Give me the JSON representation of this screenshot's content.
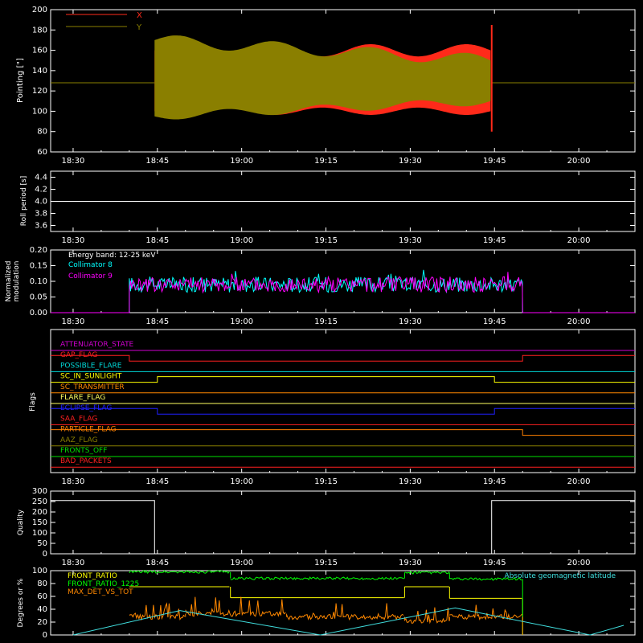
{
  "x_ticks": [
    "18:30",
    "18:45",
    "19:00",
    "19:15",
    "19:30",
    "19:45",
    "20:00"
  ],
  "chart_data": [
    {
      "type": "line",
      "ylabel": "Pointing [\"]",
      "ylim": [
        60,
        200
      ],
      "yticks": [
        60,
        80,
        100,
        120,
        140,
        160,
        180,
        200
      ],
      "series": [
        {
          "name": "X",
          "color": "#ff2a1a",
          "upper": 160,
          "lower": 100,
          "baseline": 128,
          "active": [
            "18:44:30",
            "19:44:30"
          ]
        },
        {
          "name": "Y",
          "color": "#8a7f00",
          "upper": 150,
          "lower": 110,
          "baseline": 128,
          "active": [
            "18:44:30",
            "19:44:30"
          ]
        }
      ],
      "legend_placement": "top-left"
    },
    {
      "type": "line",
      "ylabel": "Roll period [s]",
      "ylim": [
        3.5,
        4.5
      ],
      "yticks": [
        "3.6",
        "3.8",
        "4.0",
        "4.2",
        "4.4"
      ],
      "series": [
        {
          "name": "",
          "color": "#ffffff",
          "value": 4.0
        }
      ]
    },
    {
      "type": "line",
      "ylabel_lines": [
        "Normalized",
        "modulation"
      ],
      "ylim": [
        0,
        0.2
      ],
      "yticks": [
        "0.00",
        "0.05",
        "0.10",
        "0.15",
        "0.20"
      ],
      "annotation": "Energy band: 12-25 keV",
      "series": [
        {
          "name": "Collimator 8",
          "color": "#00ffff",
          "level": 0.09,
          "active": [
            "18:40",
            "19:50"
          ]
        },
        {
          "name": "Collimator 9",
          "color": "#ff00ff",
          "level": 0.09,
          "active": [
            "18:40",
            "19:50"
          ]
        }
      ]
    },
    {
      "type": "line",
      "ylabel": "Flags",
      "series": [
        {
          "name": "ATTENUATOR_STATE",
          "color": "#d000d0",
          "steps": [
            [
              "18:30",
              0
            ]
          ]
        },
        {
          "name": "GAP_FLAG",
          "color": "#ff2020",
          "steps": [
            [
              "18:30",
              1
            ],
            [
              "18:40",
              0
            ],
            [
              "19:50",
              1
            ]
          ]
        },
        {
          "name": "POSSIBLE_FLARE",
          "color": "#00d8d8",
          "steps": [
            [
              "18:30",
              0
            ]
          ]
        },
        {
          "name": "SC_IN_SUNLIGHT",
          "color": "#ffff00",
          "steps": [
            [
              "18:30",
              0
            ],
            [
              "18:45",
              1
            ],
            [
              "19:45",
              0
            ]
          ]
        },
        {
          "name": "SC_TRANSMITTER",
          "color": "#ff8800",
          "steps": [
            [
              "18:30",
              0
            ]
          ]
        },
        {
          "name": "FLARE_FLAG",
          "color": "#ffff60",
          "steps": [
            [
              "18:30",
              0
            ]
          ]
        },
        {
          "name": "ECLIPSE_FLAG",
          "color": "#2020ff",
          "steps": [
            [
              "18:30",
              1
            ],
            [
              "18:45",
              0
            ],
            [
              "19:45",
              1
            ]
          ]
        },
        {
          "name": "SAA_FLAG",
          "color": "#ff2020",
          "steps": [
            [
              "18:30",
              0
            ]
          ]
        },
        {
          "name": "PARTICLE_FLAG",
          "color": "#ff8000",
          "steps": [
            [
              "18:30",
              1
            ],
            [
              "19:50",
              0
            ]
          ]
        },
        {
          "name": "AAZ_FLAG",
          "color": "#8a7f00",
          "steps": [
            [
              "18:30",
              0
            ]
          ]
        },
        {
          "name": "FRONTS_OFF",
          "color": "#00e000",
          "steps": [
            [
              "18:30",
              0
            ]
          ]
        },
        {
          "name": "BAD_PACKETS",
          "color": "#ff2020",
          "steps": [
            [
              "18:30",
              0
            ]
          ]
        }
      ]
    },
    {
      "type": "line",
      "ylabel": "Quality",
      "ylim": [
        0,
        300
      ],
      "yticks": [
        0,
        50,
        100,
        150,
        200,
        250,
        300
      ],
      "series": [
        {
          "name": "",
          "color": "#ffffff",
          "steps": [
            [
              "18:30",
              255
            ],
            [
              "18:44:30",
              0
            ],
            [
              "19:44:30",
              255
            ]
          ]
        }
      ]
    },
    {
      "type": "line",
      "ylabel": "Degrees or %",
      "ylim": [
        0,
        100
      ],
      "yticks": [
        0,
        20,
        40,
        60,
        80,
        100
      ],
      "series": [
        {
          "name": "FRONT_RATIO",
          "color": "#ffff00",
          "steps": [
            [
              "18:40",
              75
            ],
            [
              "18:58",
              58
            ],
            [
              "19:29",
              75
            ],
            [
              "19:37",
              57
            ],
            [
              "19:50",
              null
            ]
          ]
        },
        {
          "name": "FRONT_RATIO_1225",
          "color": "#00ff00",
          "steps": [
            [
              "18:40",
              98
            ],
            [
              "18:58",
              88
            ],
            [
              "19:29",
              97
            ],
            [
              "19:37",
              87
            ],
            [
              "19:50",
              null
            ]
          ]
        },
        {
          "name": "MAX_DET_VS_TOT",
          "color": "#ff8800",
          "steps": [
            [
              "18:40",
              28
            ],
            [
              "18:50",
              33
            ],
            [
              "19:08",
              28
            ],
            [
              "19:29",
              22
            ],
            [
              "19:37",
              28
            ],
            [
              "19:50",
              null
            ]
          ]
        },
        {
          "name": "Absolute geomagnetic latitude",
          "color": "#40e0e0",
          "points": [
            [
              "18:30",
              0
            ],
            [
              "18:49",
              38
            ],
            [
              "19:14",
              0
            ],
            [
              "19:38",
              42
            ],
            [
              "20:02",
              0
            ],
            [
              "20:08",
              15
            ]
          ]
        }
      ]
    }
  ]
}
